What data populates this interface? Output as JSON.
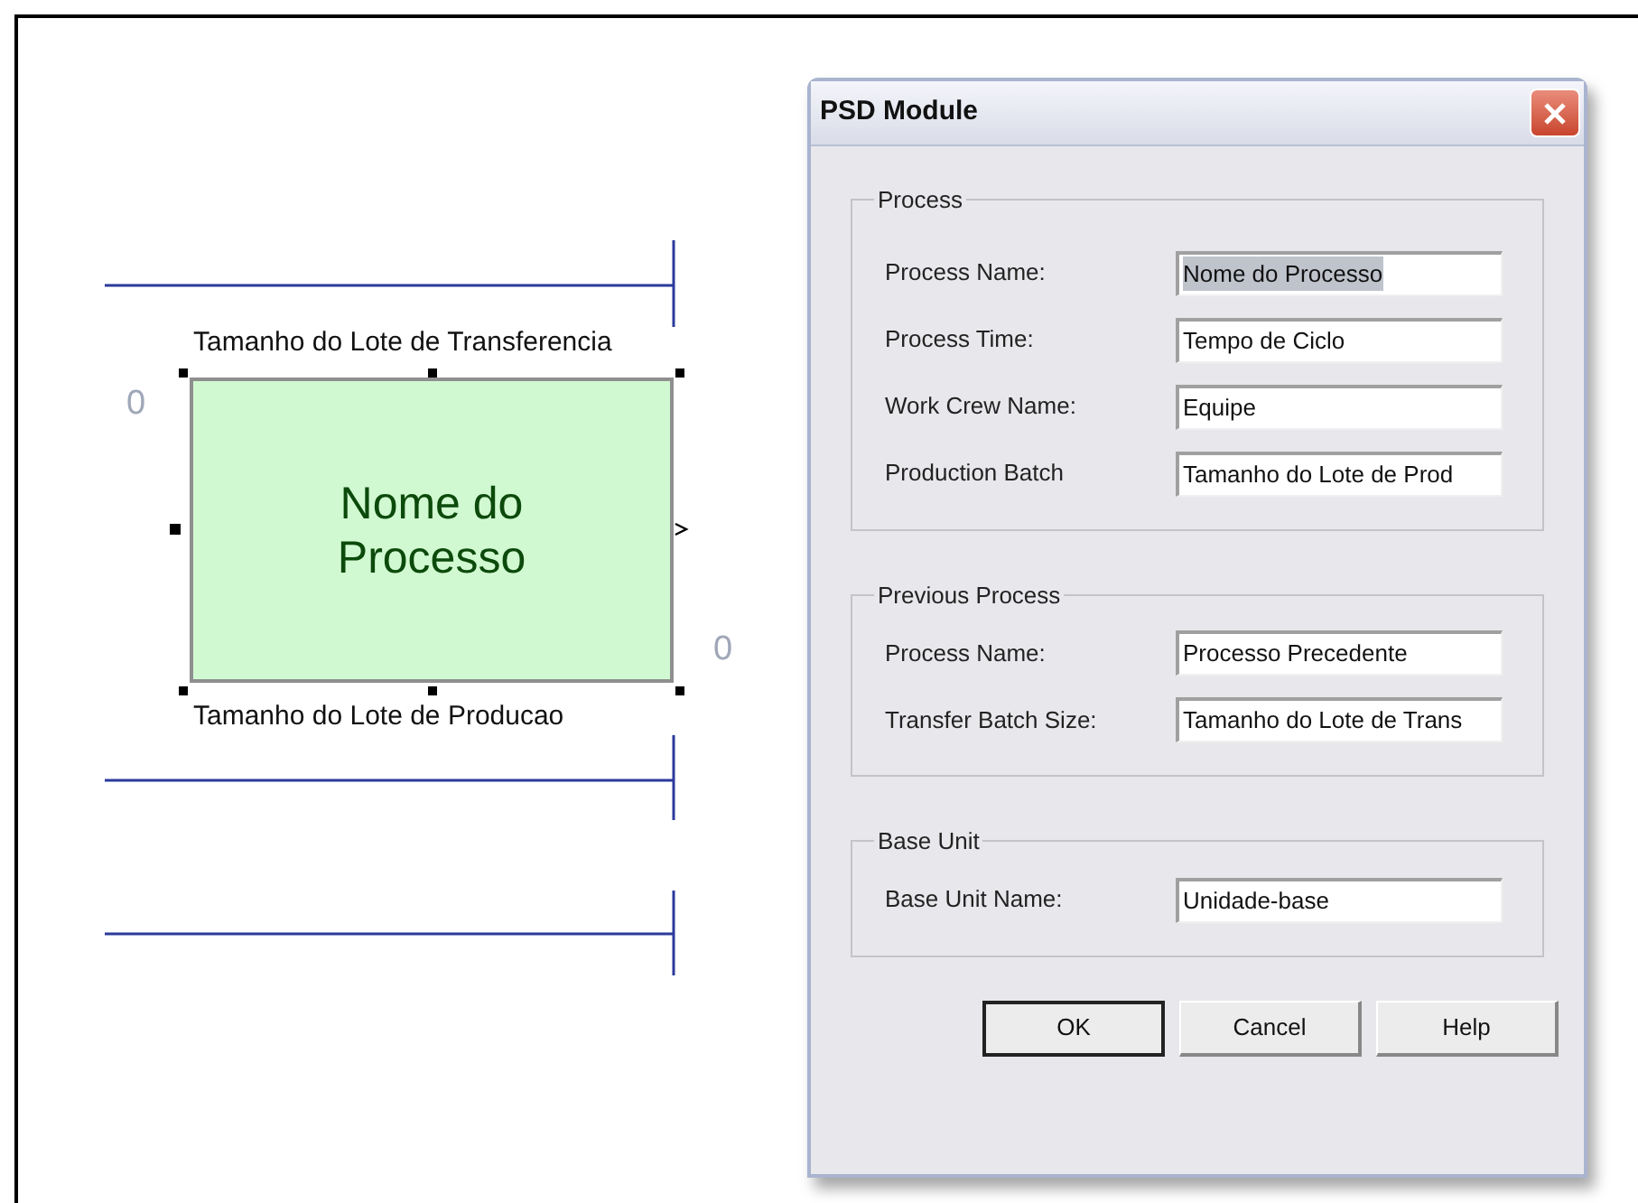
{
  "diagram": {
    "top_label": "Tamanho do Lote de Transferencia",
    "process_name": "Nome do Processo",
    "bottom_label": "Tamanho do Lote de Producao",
    "left_count": "0",
    "right_count": "0"
  },
  "dialog": {
    "title": "PSD Module",
    "groups": [
      {
        "title": "Process",
        "fields": [
          {
            "label": "Process Name:",
            "value": "Nome do Processo",
            "text_selected": true
          },
          {
            "label": "Process Time:",
            "value": "Tempo de Ciclo",
            "text_selected": false
          },
          {
            "label": "Work Crew Name:",
            "value": "Equipe",
            "text_selected": false
          },
          {
            "label": "Production Batch",
            "value": "Tamanho do Lote de Prod",
            "text_selected": false
          }
        ]
      },
      {
        "title": "Previous Process",
        "fields": [
          {
            "label": "Process Name:",
            "value": "Processo Precedente",
            "text_selected": false
          },
          {
            "label": "Transfer Batch Size:",
            "value": "Tamanho do Lote de Trans",
            "text_selected": false
          }
        ]
      },
      {
        "title": "Base Unit",
        "fields": [
          {
            "label": "Base Unit Name:",
            "value": "Unidade-base",
            "text_selected": false
          }
        ]
      }
    ],
    "buttons": [
      {
        "label": "OK",
        "default": true
      },
      {
        "label": "Cancel",
        "default": false
      },
      {
        "label": "Help",
        "default": false
      }
    ]
  }
}
